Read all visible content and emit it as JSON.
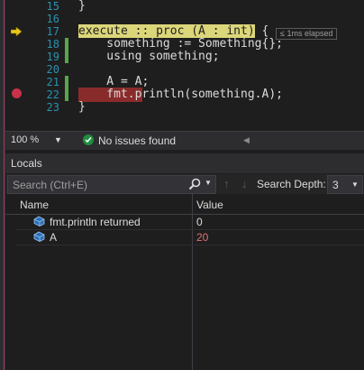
{
  "editor": {
    "lines": [
      {
        "num": "15",
        "code": "}"
      },
      {
        "num": "16",
        "code": ""
      },
      {
        "num": "17",
        "code_pre": "",
        "code_hl": "execute :: proc (A : int)",
        "code_post": " {"
      },
      {
        "num": "18",
        "code": "    something := Something{};"
      },
      {
        "num": "19",
        "code": "    using something;"
      },
      {
        "num": "20",
        "code": ""
      },
      {
        "num": "21",
        "code": "    A = A;"
      },
      {
        "num": "22",
        "code": "    fmt.println(something.A);"
      },
      {
        "num": "23",
        "code": "}"
      }
    ],
    "perf_tip": "≤ 1ms elapsed"
  },
  "status": {
    "zoom": "100 %",
    "issues": "No issues found"
  },
  "locals": {
    "title": "Locals",
    "search_placeholder": "Search (Ctrl+E)",
    "search_depth_label": "Search Depth:",
    "search_depth_value": "3",
    "columns": {
      "name": "Name",
      "value": "Value"
    },
    "rows": [
      {
        "name": "fmt.println returned",
        "value": "0",
        "changed": false
      },
      {
        "name": "A",
        "value": "20",
        "changed": true
      }
    ]
  },
  "colors": {
    "accent": "#a03c6e",
    "exec_highlight": "#dcd67a",
    "breakpoint": "#c8314a",
    "changed_value": "#e07070"
  }
}
